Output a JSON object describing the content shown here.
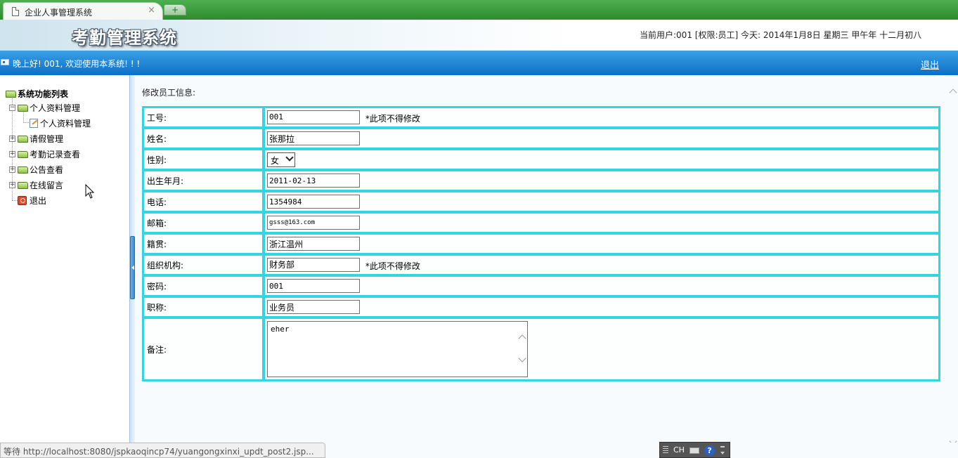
{
  "browser": {
    "tab_title": "企业人事管理系统",
    "close_label": "×",
    "newtab_label": "+"
  },
  "header": {
    "title": "考勤管理系统",
    "info": "当前用户:001 [权限:员工] 今天: 2014年1月8日 星期三 甲午年 十二月初八"
  },
  "welcome": {
    "text": "晚上好! 001, 欢迎使用本系统! ! !",
    "logout": "退出"
  },
  "sidebar": {
    "root": "系统功能列表",
    "items": [
      {
        "label": "个人资料管理"
      },
      {
        "label": "个人资料管理"
      },
      {
        "label": "请假管理"
      },
      {
        "label": "考勤记录查看"
      },
      {
        "label": "公告查看"
      },
      {
        "label": "在线留言"
      },
      {
        "label": "退出"
      }
    ]
  },
  "form": {
    "caption": "修改员工信息:",
    "readonly_note": "*此项不得修改",
    "fields": {
      "id": {
        "label": "工号:",
        "value": "001"
      },
      "name": {
        "label": "姓名:",
        "value": "张那拉"
      },
      "gender": {
        "label": "性别:",
        "value": "女"
      },
      "birth": {
        "label": "出生年月:",
        "value": "2011-02-13"
      },
      "phone": {
        "label": "电话:",
        "value": "1354984"
      },
      "email": {
        "label": "邮箱:",
        "value": "gsss@163.com"
      },
      "hometown": {
        "label": "籍贯:",
        "value": "浙江温州"
      },
      "org": {
        "label": "组织机构:",
        "value": "财务部"
      },
      "password": {
        "label": "密码:",
        "value": "001"
      },
      "title": {
        "label": "职称:",
        "value": "业务员"
      },
      "remark": {
        "label": "备注:",
        "value": "eher"
      }
    }
  },
  "status": {
    "text": "等待 http://localhost:8080/jspkaoqincp74/yuangongxinxi_updt_post2.jsp..."
  },
  "ime": {
    "label": "CH",
    "help": "?"
  }
}
